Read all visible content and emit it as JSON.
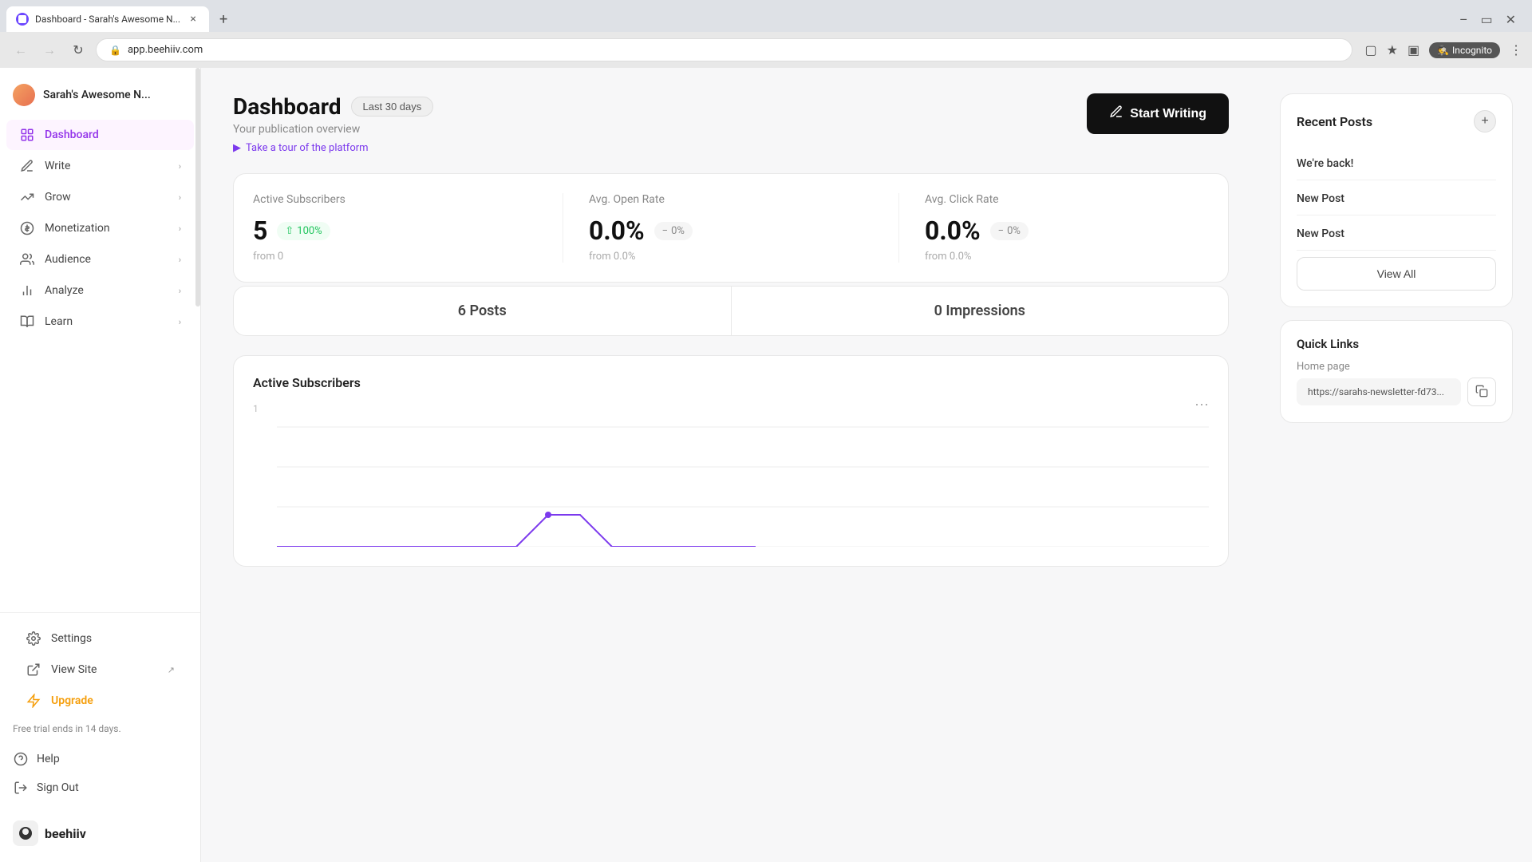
{
  "browser": {
    "tab_title": "Dashboard - Sarah's Awesome N...",
    "url": "app.beehiiv.com",
    "tab_close": "×",
    "tab_new": "+",
    "incognito_label": "Incognito"
  },
  "sidebar": {
    "pub_name": "Sarah's Awesome N...",
    "nav_items": [
      {
        "id": "dashboard",
        "label": "Dashboard",
        "active": true
      },
      {
        "id": "write",
        "label": "Write",
        "has_chevron": true
      },
      {
        "id": "grow",
        "label": "Grow",
        "has_chevron": true
      },
      {
        "id": "monetization",
        "label": "Monetization",
        "has_chevron": true
      },
      {
        "id": "audience",
        "label": "Audience",
        "has_chevron": true
      },
      {
        "id": "analyze",
        "label": "Analyze",
        "has_chevron": true
      },
      {
        "id": "learn",
        "label": "Learn",
        "has_chevron": true
      }
    ],
    "bottom_items": [
      {
        "id": "settings",
        "label": "Settings"
      },
      {
        "id": "view-site",
        "label": "View Site",
        "external": true
      },
      {
        "id": "upgrade",
        "label": "Upgrade",
        "accent": true
      }
    ],
    "trial_text": "Free trial ends in 14 days.",
    "help_items": [
      {
        "id": "help",
        "label": "Help"
      },
      {
        "id": "sign-out",
        "label": "Sign Out"
      }
    ],
    "logo_text": "beehiiv"
  },
  "dashboard": {
    "title": "Dashboard",
    "time_filter": "Last 30 days",
    "subtitle": "Your publication overview",
    "tour_link": "Take a tour of the platform",
    "start_writing": "Start Writing",
    "stats": {
      "active_subscribers": {
        "label": "Active Subscribers",
        "value": "5",
        "badge": "100%",
        "badge_type": "green",
        "from_label": "from 0"
      },
      "avg_open_rate": {
        "label": "Avg. Open Rate",
        "value": "0.0%",
        "badge": "0%",
        "badge_type": "neutral",
        "from_label": "from 0.0%"
      },
      "avg_click_rate": {
        "label": "Avg. Click Rate",
        "value": "0.0%",
        "badge": "0%",
        "badge_type": "neutral",
        "from_label": "from 0.0%"
      }
    },
    "posts_count": "6 Posts",
    "impressions_count": "0 Impressions",
    "chart": {
      "title": "Active Subscribers",
      "y_label": "1",
      "more_icon": "⋯"
    }
  },
  "right_panel": {
    "recent_posts": {
      "title": "Recent Posts",
      "add_label": "+",
      "posts": [
        {
          "title": "We're back!"
        },
        {
          "title": "New Post"
        },
        {
          "title": "New Post"
        }
      ],
      "view_all": "View All"
    },
    "quick_links": {
      "title": "Quick Links",
      "home_page_label": "Home page",
      "home_page_url": "https://sarahs-newsletter-fd73...",
      "copy_icon": "⧉"
    }
  }
}
